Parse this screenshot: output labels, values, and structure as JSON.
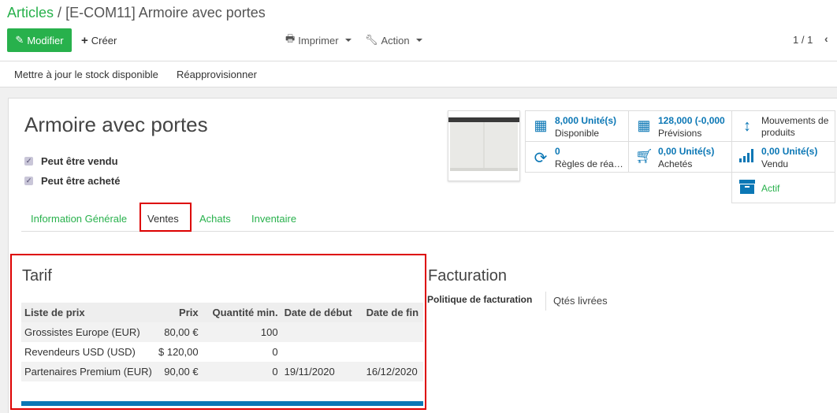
{
  "breadcrumb": {
    "parent": "Articles",
    "separator": "/",
    "current": "[E-COM11] Armoire avec portes"
  },
  "toolbar": {
    "edit": "Modifier",
    "create": "Créer",
    "print": "Imprimer",
    "action": "Action",
    "pager": "1 / 1"
  },
  "actions": {
    "update_stock": "Mettre à jour le stock disponible",
    "replenish": "Réapprovisionner"
  },
  "product": {
    "name": "Armoire avec portes",
    "can_be_sold": "Peut être vendu",
    "can_be_purchased": "Peut être acheté"
  },
  "stats": [
    {
      "value": "8,000 Unité(s)",
      "label": "Disponible",
      "icon": "building-icon"
    },
    {
      "value": "128,000 (-0,000",
      "label": "Prévisions",
      "icon": "building-icon"
    },
    {
      "value": "",
      "label": "Mouvements de produits",
      "icon": "up-down-arrow-icon"
    },
    {
      "value": "0",
      "label": "Règles de réa…",
      "icon": "refresh-icon"
    },
    {
      "value": "0,00 Unité(s)",
      "label": "Achetés",
      "icon": "cart-icon"
    },
    {
      "value": "0,00 Unité(s)",
      "label": "Vendu",
      "icon": "signal-icon"
    },
    {
      "value": "",
      "label": "Actif",
      "icon": "archive-icon"
    }
  ],
  "tabs": [
    "Information Générale",
    "Ventes",
    "Achats",
    "Inventaire"
  ],
  "tarif": {
    "title": "Tarif",
    "headers": [
      "Liste de prix",
      "Prix",
      "Quantité min.",
      "Date de début",
      "Date de fin"
    ],
    "rows": [
      [
        "Grossistes Europe (EUR)",
        "80,00 €",
        "100",
        "",
        ""
      ],
      [
        "Revendeurs USD (USD)",
        "$ 120,00",
        "0",
        "",
        ""
      ],
      [
        "Partenaires Premium (EUR)",
        "90,00 €",
        "0",
        "19/11/2020",
        "16/12/2020"
      ]
    ]
  },
  "facturation": {
    "title": "Facturation",
    "policy_label": "Politique de facturation",
    "policy_value": "Qtés livrées"
  },
  "colors": {
    "accent": "#28b14c",
    "link_blue": "#0b77b5",
    "highlight": "#dd0000"
  }
}
